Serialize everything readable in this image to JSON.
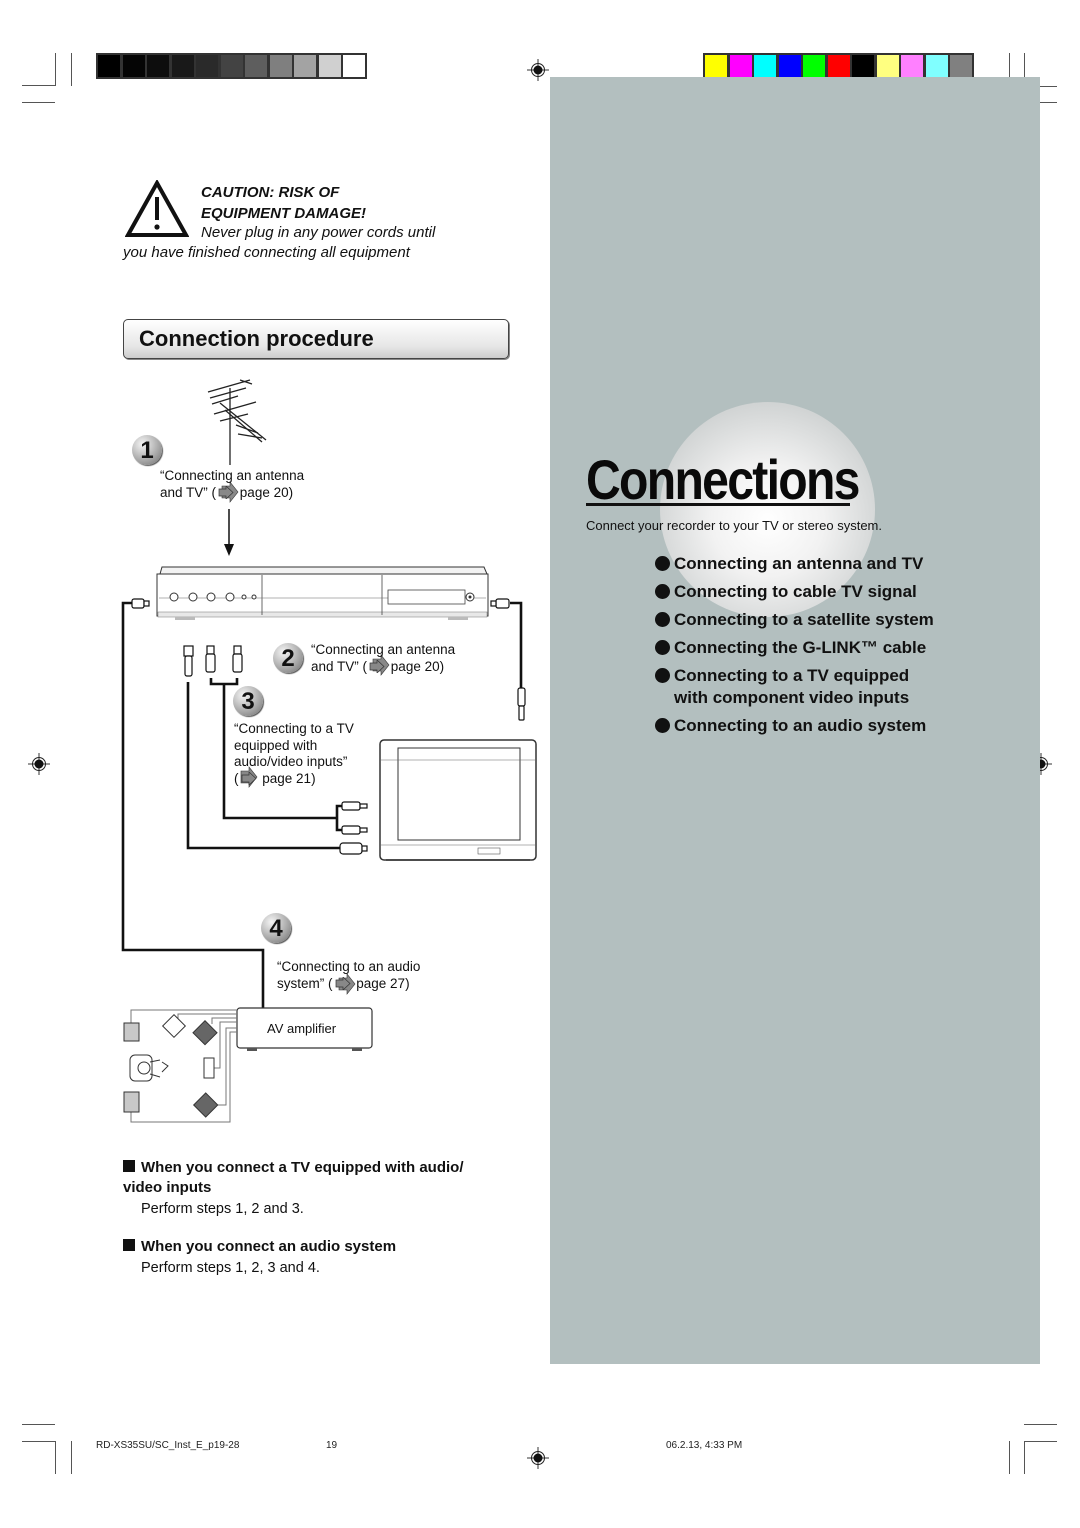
{
  "print_marks": {
    "grayscale_bar": [
      "#000000",
      "#050505",
      "#0d0d0d",
      "#191919",
      "#2a2a2a",
      "#434343",
      "#5e5e5e",
      "#7f7f7f",
      "#a3a3a3",
      "#d0d0d0",
      "#ffffff"
    ],
    "color_bar": [
      "#ffff00",
      "#ff00ff",
      "#00ffff",
      "#0000ff",
      "#00ff00",
      "#ff0000",
      "#000000",
      "#ffff80",
      "#ff80ff",
      "#80ffff",
      "#808080"
    ]
  },
  "colors": {
    "panel_bg": "#b3bfbf",
    "text": "#111111"
  },
  "caution": {
    "icon": "warning-triangle-icon",
    "title_line1": "CAUTION: RISK OF",
    "title_line2": "EQUIPMENT DAMAGE!",
    "body": "Never plug in any power cords until you have finished connecting all equipment"
  },
  "section": {
    "title": "Connection procedure"
  },
  "diagram": {
    "steps": [
      {
        "number": "1",
        "caption_line1": "“Connecting an antenna",
        "caption_pre": "and TV” (",
        "caption_page": "page 20)"
      },
      {
        "number": "2",
        "caption_line1": "“Connecting an antenna",
        "caption_pre": "and TV” (",
        "caption_page": "page 20)"
      },
      {
        "number": "3",
        "caption_line1": "“Connecting to a TV",
        "caption_line2": "equipped with",
        "caption_line3": "audio/video inputs”",
        "caption_pre": "(",
        "caption_page": "page 21)"
      },
      {
        "number": "4",
        "caption_line1": "“Connecting to an audio",
        "caption_pre": "system” (",
        "caption_page": "page 27)"
      }
    ],
    "amplifier_label": "AV amplifier"
  },
  "notes": [
    {
      "heading": "When you connect a TV equipped with audio/ video inputs",
      "body": "Perform steps 1, 2 and 3."
    },
    {
      "heading": "When you connect an audio system",
      "body": "Perform steps 1, 2, 3 and 4."
    }
  ],
  "chapter": {
    "title": "Connections",
    "subtitle": "Connect your recorder to your TV or stereo system.",
    "topics": [
      "Connecting an antenna and TV",
      "Connecting to cable TV signal",
      "Connecting to a satellite system",
      "Connecting the G-LINK™ cable",
      "Connecting to a TV equipped with component video inputs",
      "Connecting to an audio system"
    ]
  },
  "footer": {
    "file": "RD-XS35SU/SC_Inst_E_p19-28",
    "page": "19",
    "timestamp": "06.2.13, 4:33 PM"
  }
}
